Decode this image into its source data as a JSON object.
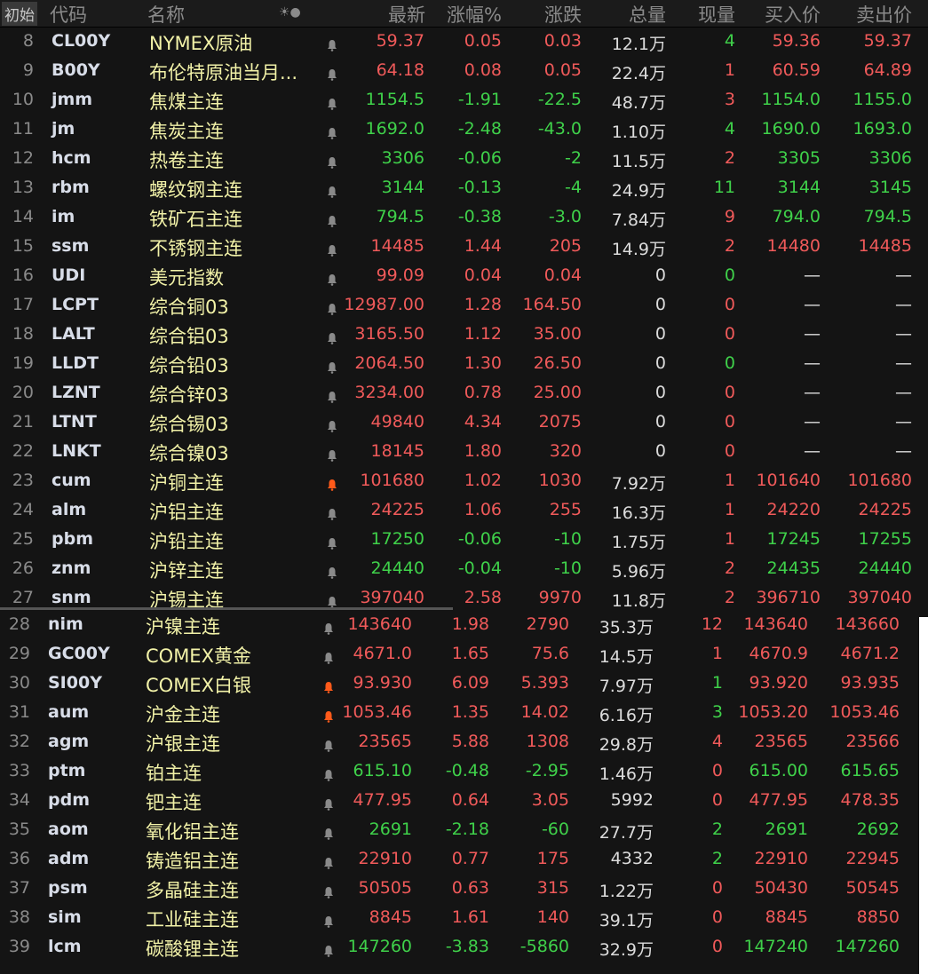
{
  "header": {
    "init": "初始",
    "code": "代码",
    "name": "名称",
    "icons": "☀●",
    "last": "最新",
    "pct": "涨幅%",
    "chg": "涨跌",
    "vol": "总量",
    "cur": "现量",
    "bid": "买入价",
    "ask": "卖出价"
  },
  "colors": {
    "up": "#f05a5a",
    "down": "#3fd14a",
    "bell": "#8a8a8a",
    "bell_active": "#ff5a1a"
  },
  "rows_top": [
    {
      "n": "8",
      "code": "CL00Y",
      "name": "NYMEX原油",
      "last": "59.37",
      "pct": "0.05",
      "chg": "0.03",
      "vol": "12.1万",
      "cur": "4",
      "bid": "59.36",
      "ask": "59.37",
      "dir": "up",
      "cd": "dn",
      "bell": "off"
    },
    {
      "n": "9",
      "code": "B00Y",
      "name": "布伦特原油当月...",
      "last": "64.18",
      "pct": "0.08",
      "chg": "0.05",
      "vol": "22.4万",
      "cur": "1",
      "bid": "60.59",
      "ask": "64.89",
      "dir": "up",
      "cd": "up",
      "bell": "off"
    },
    {
      "n": "10",
      "code": "jmm",
      "name": "焦煤主连",
      "last": "1154.5",
      "pct": "-1.91",
      "chg": "-22.5",
      "vol": "48.7万",
      "cur": "3",
      "bid": "1154.0",
      "ask": "1155.0",
      "dir": "dn",
      "cd": "up",
      "bell": "off"
    },
    {
      "n": "11",
      "code": "jm",
      "name": "焦炭主连",
      "last": "1692.0",
      "pct": "-2.48",
      "chg": "-43.0",
      "vol": "1.10万",
      "cur": "4",
      "bid": "1690.0",
      "ask": "1693.0",
      "dir": "dn",
      "cd": "dn",
      "bell": "off"
    },
    {
      "n": "12",
      "code": "hcm",
      "name": "热卷主连",
      "last": "3306",
      "pct": "-0.06",
      "chg": "-2",
      "vol": "11.5万",
      "cur": "2",
      "bid": "3305",
      "ask": "3306",
      "dir": "dn",
      "cd": "up",
      "bell": "off"
    },
    {
      "n": "13",
      "code": "rbm",
      "name": "螺纹钢主连",
      "last": "3144",
      "pct": "-0.13",
      "chg": "-4",
      "vol": "24.9万",
      "cur": "11",
      "bid": "3144",
      "ask": "3145",
      "dir": "dn",
      "cd": "dn",
      "bell": "off"
    },
    {
      "n": "14",
      "code": "im",
      "name": "铁矿石主连",
      "last": "794.5",
      "pct": "-0.38",
      "chg": "-3.0",
      "vol": "7.84万",
      "cur": "9",
      "bid": "794.0",
      "ask": "794.5",
      "dir": "dn",
      "cd": "up",
      "bell": "off"
    },
    {
      "n": "15",
      "code": "ssm",
      "name": "不锈钢主连",
      "last": "14485",
      "pct": "1.44",
      "chg": "205",
      "vol": "14.9万",
      "cur": "2",
      "bid": "14480",
      "ask": "14485",
      "dir": "up",
      "cd": "up",
      "bell": "off"
    },
    {
      "n": "16",
      "code": "UDI",
      "name": "美元指数",
      "last": "99.09",
      "pct": "0.04",
      "chg": "0.04",
      "vol": "0",
      "cur": "0",
      "bid": "—",
      "ask": "—",
      "dir": "up",
      "cd": "dn",
      "bell": "off"
    },
    {
      "n": "17",
      "code": "LCPT",
      "name": "综合铜03",
      "last": "12987.00",
      "pct": "1.28",
      "chg": "164.50",
      "vol": "0",
      "cur": "0",
      "bid": "—",
      "ask": "—",
      "dir": "up",
      "cd": "up",
      "bell": "off"
    },
    {
      "n": "18",
      "code": "LALT",
      "name": "综合铝03",
      "last": "3165.50",
      "pct": "1.12",
      "chg": "35.00",
      "vol": "0",
      "cur": "0",
      "bid": "—",
      "ask": "—",
      "dir": "up",
      "cd": "up",
      "bell": "off"
    },
    {
      "n": "19",
      "code": "LLDT",
      "name": "综合铅03",
      "last": "2064.50",
      "pct": "1.30",
      "chg": "26.50",
      "vol": "0",
      "cur": "0",
      "bid": "—",
      "ask": "—",
      "dir": "up",
      "cd": "dn",
      "bell": "off"
    },
    {
      "n": "20",
      "code": "LZNT",
      "name": "综合锌03",
      "last": "3234.00",
      "pct": "0.78",
      "chg": "25.00",
      "vol": "0",
      "cur": "0",
      "bid": "—",
      "ask": "—",
      "dir": "up",
      "cd": "up",
      "bell": "off"
    },
    {
      "n": "21",
      "code": "LTNT",
      "name": "综合锡03",
      "last": "49840",
      "pct": "4.34",
      "chg": "2075",
      "vol": "0",
      "cur": "0",
      "bid": "—",
      "ask": "—",
      "dir": "up",
      "cd": "up",
      "bell": "off"
    },
    {
      "n": "22",
      "code": "LNKT",
      "name": "综合镍03",
      "last": "18145",
      "pct": "1.80",
      "chg": "320",
      "vol": "0",
      "cur": "0",
      "bid": "—",
      "ask": "—",
      "dir": "up",
      "cd": "up",
      "bell": "off"
    },
    {
      "n": "23",
      "code": "cum",
      "name": "沪铜主连",
      "last": "101680",
      "pct": "1.02",
      "chg": "1030",
      "vol": "7.92万",
      "cur": "1",
      "bid": "101640",
      "ask": "101680",
      "dir": "up",
      "cd": "up",
      "bell": "on"
    },
    {
      "n": "24",
      "code": "alm",
      "name": "沪铝主连",
      "last": "24225",
      "pct": "1.06",
      "chg": "255",
      "vol": "16.3万",
      "cur": "1",
      "bid": "24220",
      "ask": "24225",
      "dir": "up",
      "cd": "up",
      "bell": "off"
    },
    {
      "n": "25",
      "code": "pbm",
      "name": "沪铅主连",
      "last": "17250",
      "pct": "-0.06",
      "chg": "-10",
      "vol": "1.75万",
      "cur": "1",
      "bid": "17245",
      "ask": "17255",
      "dir": "dn",
      "cd": "up",
      "bell": "off"
    },
    {
      "n": "26",
      "code": "znm",
      "name": "沪锌主连",
      "last": "24440",
      "pct": "-0.04",
      "chg": "-10",
      "vol": "5.96万",
      "cur": "2",
      "bid": "24435",
      "ask": "24440",
      "dir": "dn",
      "cd": "up",
      "bell": "off"
    },
    {
      "n": "27",
      "code": "snm",
      "name": "沪锡主连",
      "last": "397040",
      "pct": "2.58",
      "chg": "9970",
      "vol": "11.8万",
      "cur": "2",
      "bid": "396710",
      "ask": "397040",
      "dir": "up",
      "cd": "up",
      "bell": "off"
    }
  ],
  "rows_bottom": [
    {
      "n": "28",
      "code": "nim",
      "name": "沪镍主连",
      "last": "143640",
      "pct": "1.98",
      "chg": "2790",
      "vol": "35.3万",
      "cur": "12",
      "bid": "143640",
      "ask": "143660",
      "dir": "up",
      "cd": "up",
      "bell": "off"
    },
    {
      "n": "29",
      "code": "GC00Y",
      "name": "COMEX黄金",
      "last": "4671.0",
      "pct": "1.65",
      "chg": "75.6",
      "vol": "14.5万",
      "cur": "1",
      "bid": "4670.9",
      "ask": "4671.2",
      "dir": "up",
      "cd": "up",
      "bell": "off"
    },
    {
      "n": "30",
      "code": "SI00Y",
      "name": "COMEX白银",
      "last": "93.930",
      "pct": "6.09",
      "chg": "5.393",
      "vol": "7.97万",
      "cur": "1",
      "bid": "93.920",
      "ask": "93.935",
      "dir": "up",
      "cd": "dn",
      "bell": "on"
    },
    {
      "n": "31",
      "code": "aum",
      "name": "沪金主连",
      "last": "1053.46",
      "pct": "1.35",
      "chg": "14.02",
      "vol": "6.16万",
      "cur": "3",
      "bid": "1053.20",
      "ask": "1053.46",
      "dir": "up",
      "cd": "dn",
      "bell": "on"
    },
    {
      "n": "32",
      "code": "agm",
      "name": "沪银主连",
      "last": "23565",
      "pct": "5.88",
      "chg": "1308",
      "vol": "29.8万",
      "cur": "4",
      "bid": "23565",
      "ask": "23566",
      "dir": "up",
      "cd": "up",
      "bell": "off"
    },
    {
      "n": "33",
      "code": "ptm",
      "name": "铂主连",
      "last": "615.10",
      "pct": "-0.48",
      "chg": "-2.95",
      "vol": "1.46万",
      "cur": "0",
      "bid": "615.00",
      "ask": "615.65",
      "dir": "dn",
      "cd": "up",
      "bell": "off"
    },
    {
      "n": "34",
      "code": "pdm",
      "name": "钯主连",
      "last": "477.95",
      "pct": "0.64",
      "chg": "3.05",
      "vol": "5992",
      "cur": "0",
      "bid": "477.95",
      "ask": "478.35",
      "dir": "up",
      "cd": "up",
      "bell": "off"
    },
    {
      "n": "35",
      "code": "aom",
      "name": "氧化铝主连",
      "last": "2691",
      "pct": "-2.18",
      "chg": "-60",
      "vol": "27.7万",
      "cur": "2",
      "bid": "2691",
      "ask": "2692",
      "dir": "dn",
      "cd": "dn",
      "bell": "off"
    },
    {
      "n": "36",
      "code": "adm",
      "name": "铸造铝主连",
      "last": "22910",
      "pct": "0.77",
      "chg": "175",
      "vol": "4332",
      "cur": "2",
      "bid": "22910",
      "ask": "22945",
      "dir": "up",
      "cd": "dn",
      "bell": "off"
    },
    {
      "n": "37",
      "code": "psm",
      "name": "多晶硅主连",
      "last": "50505",
      "pct": "0.63",
      "chg": "315",
      "vol": "1.22万",
      "cur": "0",
      "bid": "50430",
      "ask": "50545",
      "dir": "up",
      "cd": "up",
      "bell": "off"
    },
    {
      "n": "38",
      "code": "sim",
      "name": "工业硅主连",
      "last": "8845",
      "pct": "1.61",
      "chg": "140",
      "vol": "39.1万",
      "cur": "0",
      "bid": "8845",
      "ask": "8850",
      "dir": "up",
      "cd": "up",
      "bell": "off"
    },
    {
      "n": "39",
      "code": "lcm",
      "name": "碳酸锂主连",
      "last": "147260",
      "pct": "-3.83",
      "chg": "-5860",
      "vol": "32.9万",
      "cur": "0",
      "bid": "147240",
      "ask": "147260",
      "dir": "dn",
      "cd": "up",
      "bell": "off"
    }
  ]
}
